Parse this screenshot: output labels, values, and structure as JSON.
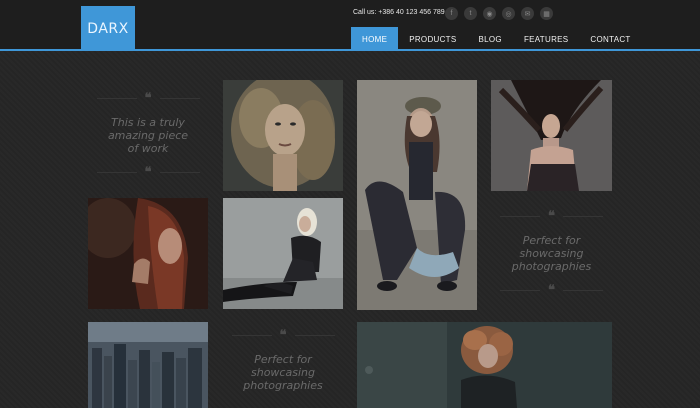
{
  "header": {
    "logo": "DARX",
    "contact": "Call us: +386 40 123 456 789",
    "social_icons": [
      "facebook-icon",
      "twitter-icon",
      "rss-icon",
      "dribbble-icon",
      "email-icon",
      "windows-icon"
    ]
  },
  "nav": {
    "items": [
      {
        "label": "HOME",
        "active": true
      },
      {
        "label": "PRODUCTS",
        "active": false
      },
      {
        "label": "BLOG",
        "active": false
      },
      {
        "label": "FEATURES",
        "active": false
      },
      {
        "label": "CONTACT",
        "active": false
      }
    ]
  },
  "quotes": [
    {
      "line1": "This is a truly",
      "line2": "amazing piece",
      "line3": "of work"
    },
    {
      "line1": "Perfect for",
      "line2": "showcasing",
      "line3": "photographies"
    },
    {
      "line1": "Perfect for",
      "line2": "showcasing",
      "line3": "photographies"
    }
  ],
  "quote_mark": "❝"
}
